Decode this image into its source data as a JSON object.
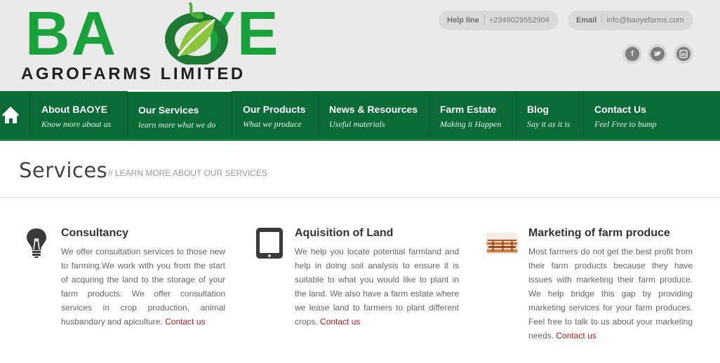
{
  "brand": {
    "logo_main": "BAOYE",
    "logo_sub": "AGROFARMS LIMITED",
    "colors": {
      "green": "#19a23b",
      "nav_green": "#0a6b36",
      "link_red": "#b3171b"
    }
  },
  "contact": {
    "help_label": "Help line",
    "help_value": "+2348029552904",
    "email_label": "Email",
    "email_value": "info@baoyefarms.com"
  },
  "social": [
    {
      "name": "facebook-icon",
      "glyph": "f"
    },
    {
      "name": "twitter-icon",
      "glyph": "t"
    },
    {
      "name": "linkedin-icon",
      "glyph": "in"
    }
  ],
  "nav": {
    "home_icon": "home-icon",
    "items": [
      {
        "title": "About BAOYE",
        "subtitle": "Know more about us"
      },
      {
        "title": "Our Services",
        "subtitle": "learn more what we do"
      },
      {
        "title": "Our Products",
        "subtitle": "What we produce"
      },
      {
        "title": "News & Resources",
        "subtitle": "Useful materials"
      },
      {
        "title": "Farm Estate",
        "subtitle": "Making it Happen"
      },
      {
        "title": "Blog",
        "subtitle": "Say it as it is"
      },
      {
        "title": "Contact Us",
        "subtitle": "Feel Free to bump"
      }
    ],
    "active_index": 1
  },
  "page": {
    "title": "Services",
    "subtitle": "// LEARN MORE ABOUT OUR SERVICES"
  },
  "services": [
    {
      "icon": "lightbulb-icon",
      "title": "Consultancy",
      "text": "We offer consultation services to those new to farming.We work with you from the start of acquring the land to the storage of your farm products. We offer consultation services in crop production, animal husbandary and apiculture.",
      "link": "Contact us"
    },
    {
      "icon": "tablet-icon",
      "title": "Aquisition of Land",
      "text": "We help you locate potential farmland and help in doing soil analysis to ensure it is suitable to what you would like to plant in the land. We also have a farm estate where we lease land to farmers to plant different crops.",
      "link": "Contact us"
    },
    {
      "icon": "farm-produce-image",
      "title": "Marketing of farm produce",
      "text": "Most farmers do not get the best profit from their farm products because they have issues with marketing their farm produce. We help bridge this gap by providing marketing services for your farm produces. Feel free to talk to us about your marketing needs.",
      "link": "Contact us"
    }
  ]
}
